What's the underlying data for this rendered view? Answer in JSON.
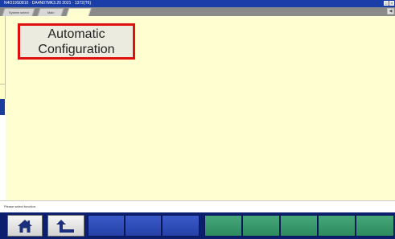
{
  "window": {
    "title": "N4O19S0810 · DA4N07MK3.20 2021 · 1372(T6)"
  },
  "tabs": [
    {
      "label": "System select",
      "active": false
    },
    {
      "label": "Main",
      "active": false
    },
    {
      "label": "",
      "active": true
    }
  ],
  "main": {
    "automatic_configuration": {
      "line1": "Automatic",
      "line2": "Configuration"
    }
  },
  "status": {
    "text": "Please select function."
  },
  "footer": {
    "buttons": [
      {
        "name": "home-button",
        "icon": "home-icon"
      },
      {
        "name": "back-button",
        "icon": "return-arrow-icon"
      }
    ]
  },
  "colors": {
    "title_bar": "#1a3da8",
    "content_background": "#fffed0",
    "highlight_border": "#e01010",
    "footer_background": "#0c1e6e",
    "footer_blue_buttons": "#3050b8",
    "footer_green_buttons": "#3a9a6c"
  }
}
